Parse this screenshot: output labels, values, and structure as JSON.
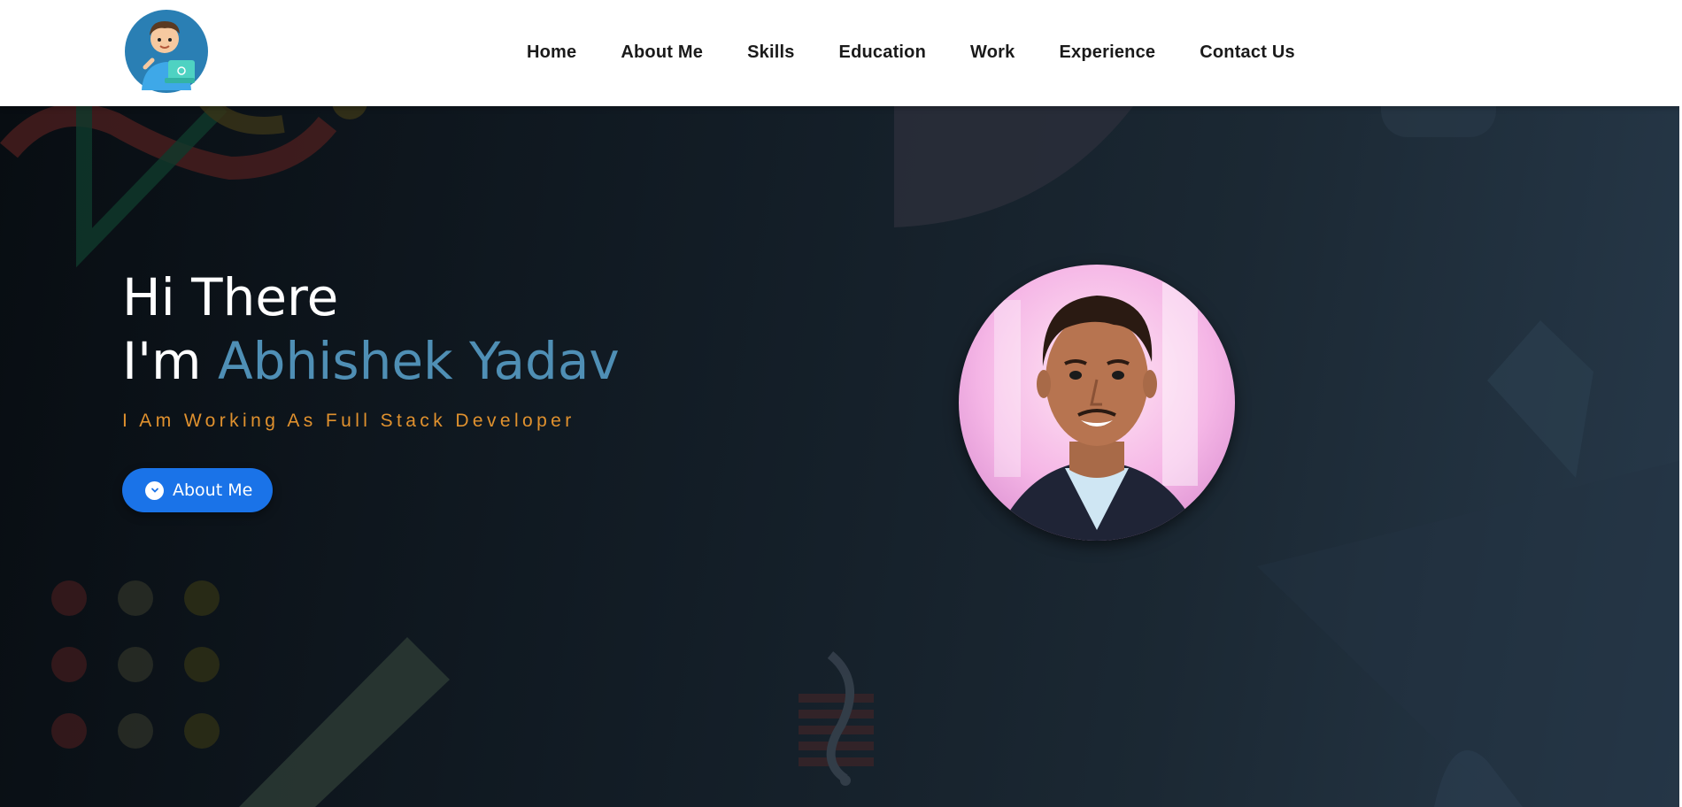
{
  "header": {
    "logo_icon": "developer-avatar-icon",
    "nav": [
      {
        "label": "Home"
      },
      {
        "label": "About Me"
      },
      {
        "label": "Skills"
      },
      {
        "label": "Education"
      },
      {
        "label": "Work"
      },
      {
        "label": "Experience"
      },
      {
        "label": "Contact Us"
      }
    ]
  },
  "hero": {
    "greeting_line1": "Hi There",
    "greeting_prefix": "I'm ",
    "name": "Abhishek Yadav",
    "tagline": "I Am Working As Full Stack Developer",
    "cta_label": "About Me",
    "cta_icon": "chevron-down-circle-icon",
    "portrait_icon": "profile-photo"
  },
  "colors": {
    "accent_name": "#4f8fb5",
    "tagline": "#e0912e",
    "cta_bg": "#1a73e8",
    "hero_bg_start": "#080d12",
    "hero_bg_end": "#27394a"
  }
}
